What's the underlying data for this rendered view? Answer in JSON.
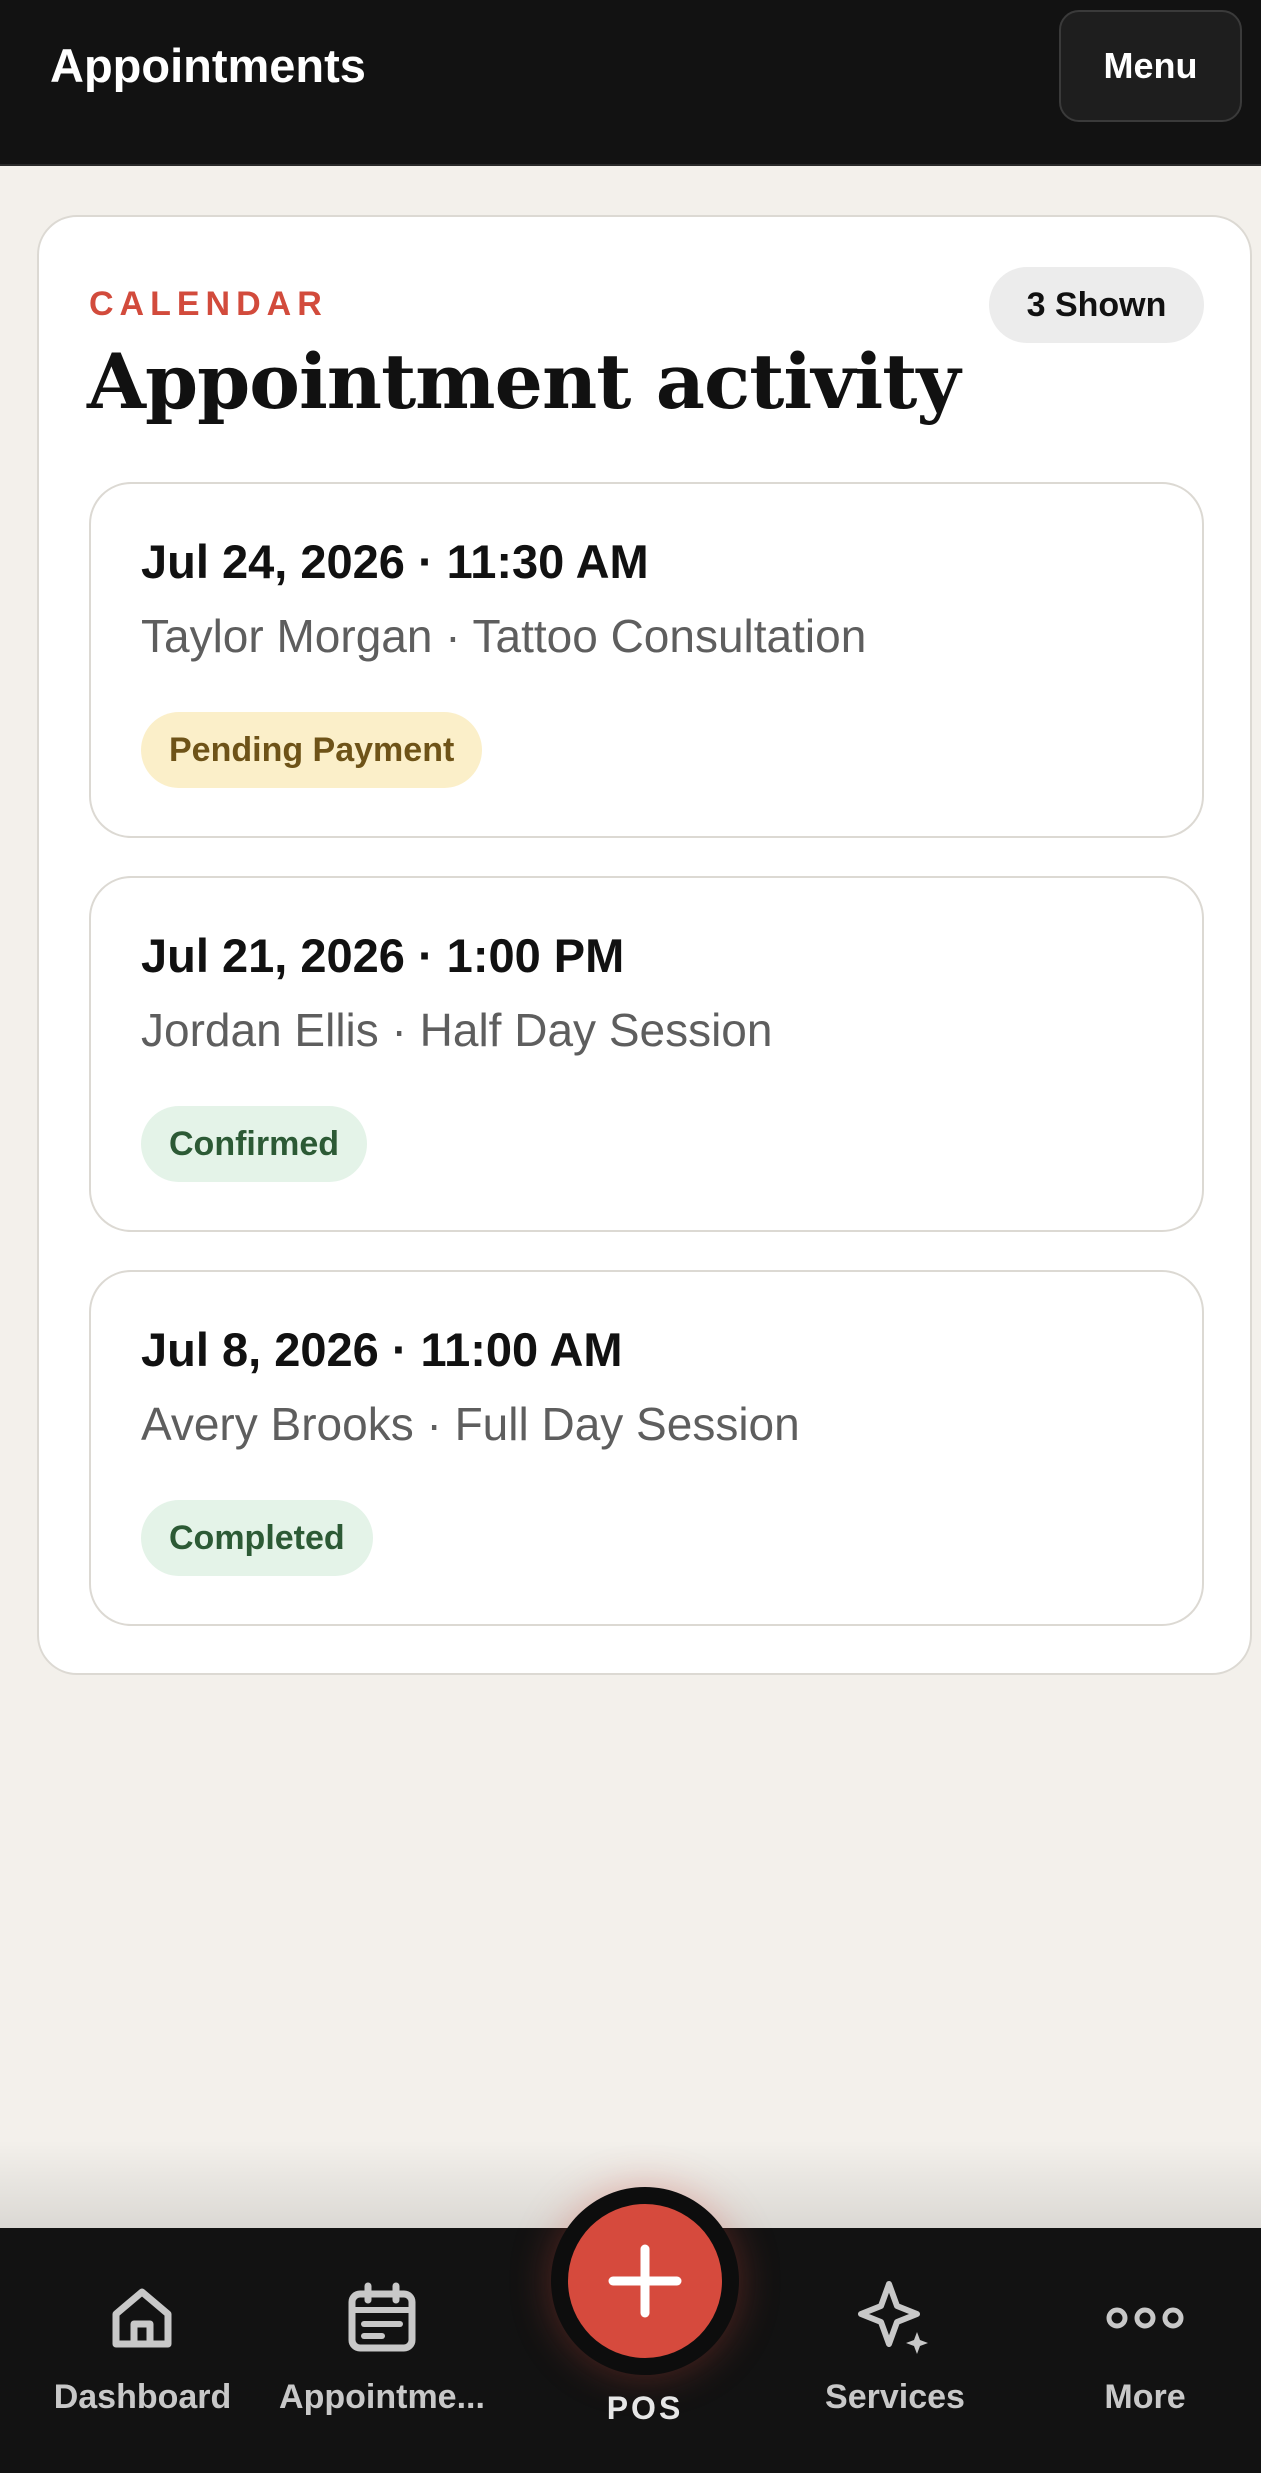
{
  "header": {
    "title": "Appointments",
    "menu_label": "Menu"
  },
  "calendar_card": {
    "eyebrow": "CALENDAR",
    "count_badge": "3 Shown",
    "heading": "Appointment activity",
    "appointments": [
      {
        "when": "Jul 24, 2026 · 11:30 AM",
        "who": "Taylor Morgan · Tattoo Consultation",
        "status": "Pending Payment"
      },
      {
        "when": "Jul 21, 2026 · 1:00 PM",
        "who": "Jordan Ellis · Half Day Session",
        "status": "Confirmed"
      },
      {
        "when": "Jul 8, 2026 · 11:00 AM",
        "who": "Avery Brooks · Full Day Session",
        "status": "Completed"
      }
    ]
  },
  "bottom_nav": {
    "items": [
      {
        "label": "Dashboard",
        "icon": "home-icon"
      },
      {
        "label": "Appointme...",
        "icon": "calendar-icon"
      },
      {
        "label": "POS",
        "icon": "plus-icon"
      },
      {
        "label": "Services",
        "icon": "sparkle-icon"
      },
      {
        "label": "More",
        "icon": "more-dots-icon"
      }
    ]
  },
  "colors": {
    "accent": "#d64a3d",
    "pending_bg": "#fbefc9",
    "confirmed_bg": "#e4f3e8",
    "nav_bg": "#121212"
  }
}
